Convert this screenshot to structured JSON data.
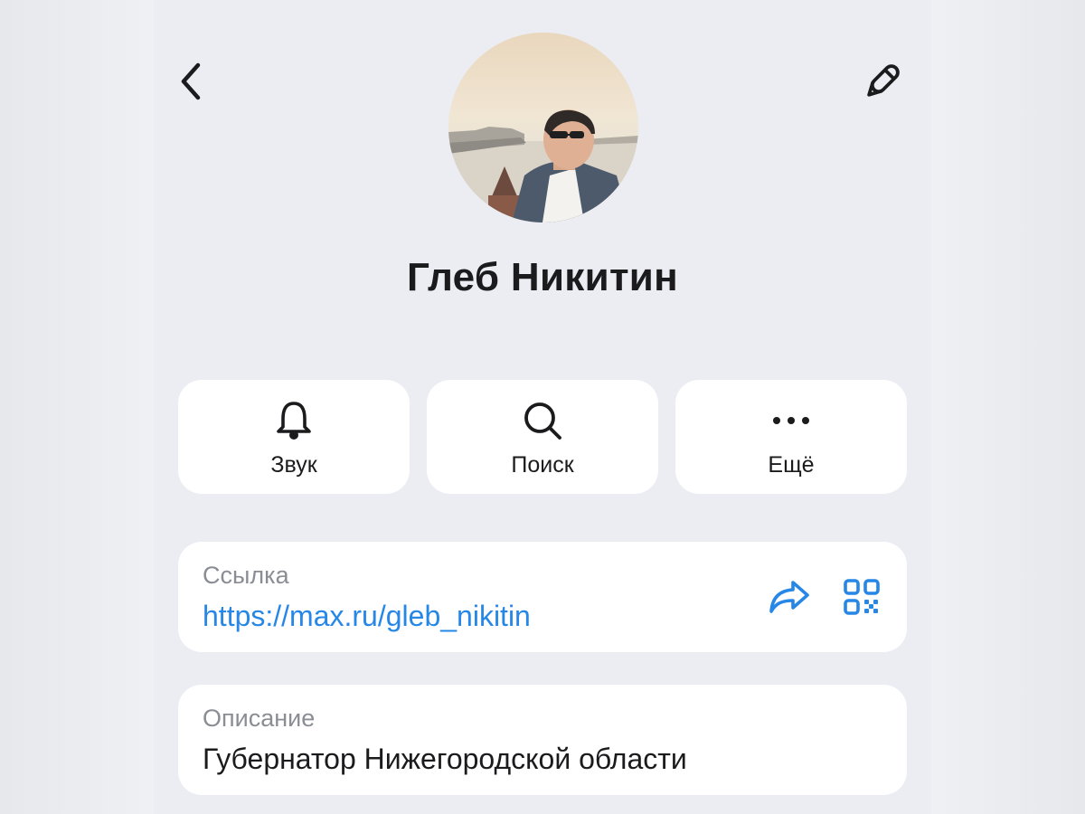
{
  "profile": {
    "name": "Глеб Никитин"
  },
  "actions": [
    {
      "label": "Звук",
      "icon": "bell-icon"
    },
    {
      "label": "Поиск",
      "icon": "search-icon"
    },
    {
      "label": "Ещё",
      "icon": "more-dots-icon"
    }
  ],
  "link": {
    "caption": "Ссылка",
    "value": "https://max.ru/gleb_nikitin"
  },
  "description": {
    "caption": "Описание",
    "value": "Губернатор Нижегородской области"
  },
  "colors": {
    "accent": "#2687e6",
    "background": "#ebedf2",
    "card": "#ffffff",
    "caption": "#8a8d94"
  }
}
